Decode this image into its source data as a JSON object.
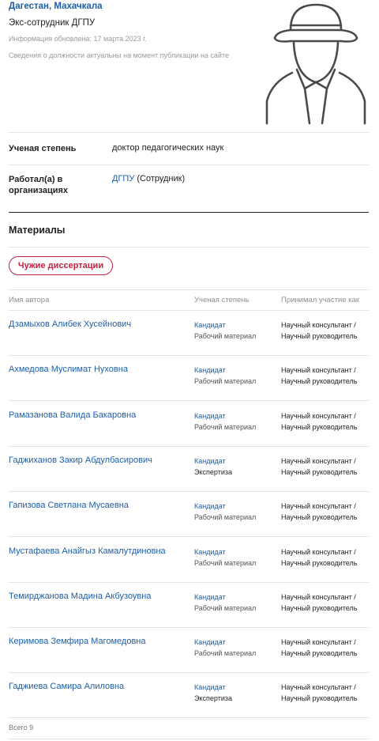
{
  "profile": {
    "location": "Дагестан, Махачкала",
    "role": "Экс-сотрудник ДГПУ",
    "updated": "Информация обновлена: 17 марта 2023 г.",
    "note": "Сведения о должности актуальны на момент публикации на сайте",
    "avatar_icon": "incognito-avatar-icon"
  },
  "info": {
    "degree_label": "Ученая степень",
    "degree_value": "доктор педагогических наук",
    "org_label": "Работал(а) в организациях",
    "org_link": "ДГПУ",
    "org_suffix": " (Сотрудник)"
  },
  "materials": {
    "title": "Материалы",
    "filter_button": "Чужие диссертации",
    "columns": [
      "Имя автора",
      "Ученая степень",
      "Принимал участие как"
    ],
    "rows": [
      {
        "name": "Дзамыхов Алибек Хусейнович",
        "degree": "Кандидат",
        "material": "Рабочий материал",
        "participation": "Научный консультант / Научный руководитель"
      },
      {
        "name": "Ахмедова Муслимат Нуховна",
        "degree": "Кандидат",
        "material": "Рабочий материал",
        "participation": "Научный консультант / Научный руководитель"
      },
      {
        "name": "Рамазанова Валида Бакаровна",
        "degree": "Кандидат",
        "material": "Рабочий материал",
        "participation": "Научный консультант / Научный руководитель"
      },
      {
        "name": "Гаджиханов Закир Абдулбасирович",
        "degree": "Кандидат",
        "material": "Экспертиза",
        "participation": "Научный консультант / Научный руководитель"
      },
      {
        "name": "Гапизова Светлана Мусаевна",
        "degree": "Кандидат",
        "material": "Рабочий материал",
        "participation": "Научный консультант / Научный руководитель"
      },
      {
        "name": "Мустафаева Анайгыз Камалутдиновна",
        "degree": "Кандидат",
        "material": "Рабочий материал",
        "participation": "Научный консультант / Научный руководитель"
      },
      {
        "name": "Темирджанова Мадина Акбузоувна",
        "degree": "Кандидат",
        "material": "Рабочий материал",
        "participation": "Научный консультант / Научный руководитель"
      },
      {
        "name": "Керимова Земфира Магомедовна",
        "degree": "Кандидат",
        "material": "Рабочий материал",
        "participation": "Научный консультант / Научный руководитель"
      },
      {
        "name": "Гаджиева Самира Алиловна",
        "degree": "Кандидат",
        "material": "Экспертиза",
        "participation": "Научный консультант / Научный руководитель"
      }
    ],
    "total": "Всего 9"
  },
  "colors": {
    "link": "#1d5fa8",
    "accent": "#c6203f",
    "muted": "#9a9a9a"
  }
}
